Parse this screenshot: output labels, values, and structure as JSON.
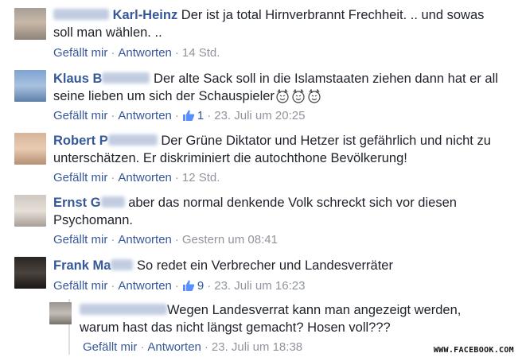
{
  "comments": [
    {
      "name_suffix": "Karl-Heinz",
      "text": "Der ist ja total Hirnverbrannt Frechheit. .. und sowas soll man wählen. ..",
      "like_label": "Gefällt mir",
      "reply_label": "Antworten",
      "likes": "",
      "time": "14 Std."
    },
    {
      "name_prefix": "Klaus B",
      "text": "Der alte Sack soll in die Islamstaaten ziehen dann hat er all seine lieben um sich der Schauspieler",
      "like_label": "Gefällt mir",
      "reply_label": "Antworten",
      "likes": "1",
      "time": "23. Juli um 20:25"
    },
    {
      "name_prefix": "Robert P",
      "text": "Der Grüne Diktator und Hetzer ist gefährlich und nicht zu unterschätzen. Er diskriminiert die autochthone Bevölkerung!",
      "like_label": "Gefällt mir",
      "reply_label": "Antworten",
      "likes": "",
      "time": "12 Std."
    },
    {
      "name_prefix": "Ernst G",
      "text": "aber das normal denkende Volk schreckt sich vor diesen Psychomann.",
      "like_label": "Gefällt mir",
      "reply_label": "Antworten",
      "likes": "",
      "time": "Gestern um 08:41"
    },
    {
      "name_prefix": "Frank Ma",
      "text": "So redet ein Verbrecher und Landesverräter",
      "like_label": "Gefällt mir",
      "reply_label": "Antworten",
      "likes": "9",
      "time": "23. Juli um 16:23"
    }
  ],
  "reply": {
    "text": "Wegen Landesverrat kann man angezeigt werden, warum hast das nicht längst gemacht? Hosen voll???",
    "like_label": "Gefällt mir",
    "reply_label": "Antworten",
    "time": "23. Juli um 18:38"
  },
  "watermark": "WWW.FACEBOOK.COM",
  "colors": {
    "link": "#365899",
    "meta": "#90949c",
    "text": "#1d2129"
  }
}
